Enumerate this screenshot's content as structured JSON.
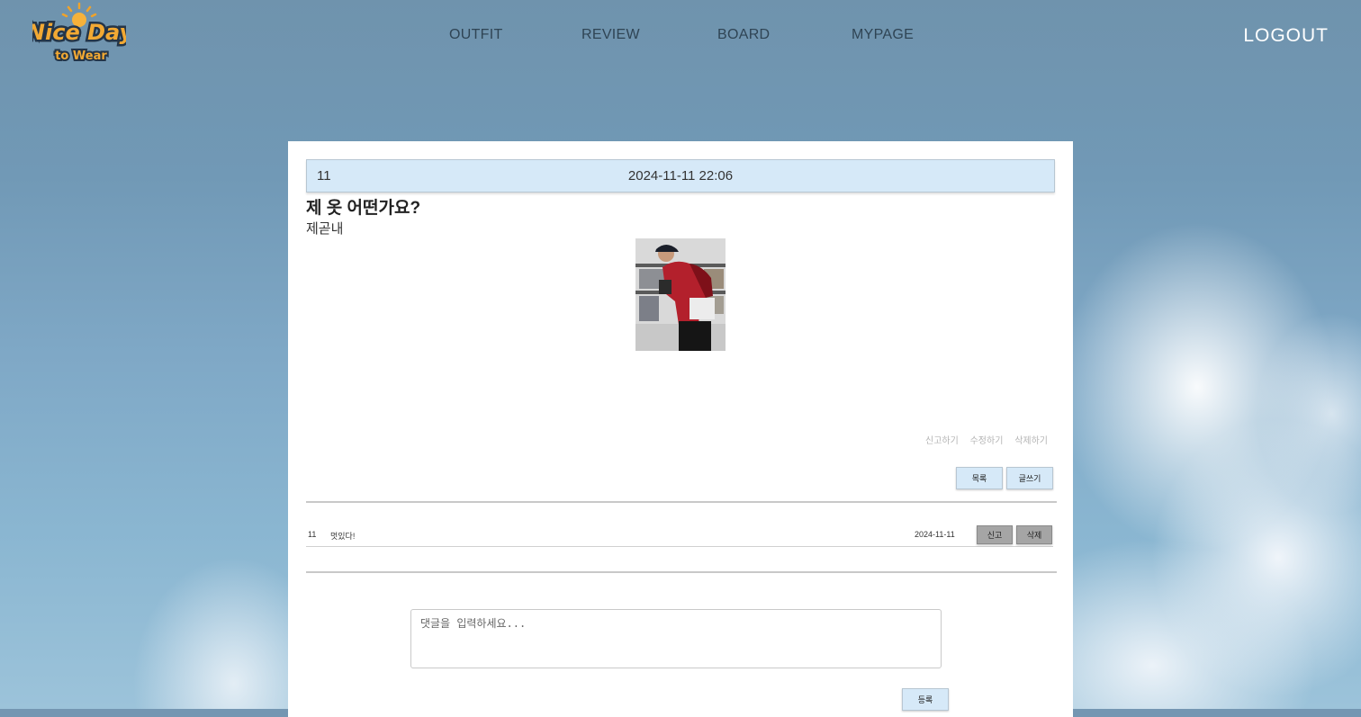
{
  "brand": {
    "line1": "Nice Day",
    "line2": "to Wear"
  },
  "nav": {
    "items": [
      "OUTFIT",
      "REVIEW",
      "BOARD",
      "MYPAGE"
    ],
    "logout": "LOGOUT"
  },
  "post": {
    "number": "11",
    "datetime": "2024-11-11 22:06",
    "title": "제 옷 어떤가요?",
    "author": "제곧내",
    "actions": {
      "report": "신고하기",
      "edit": "수정하기",
      "delete": "삭제하기"
    },
    "buttons": {
      "list": "목록",
      "write": "글쓰기"
    }
  },
  "comments": [
    {
      "number": "11",
      "text": "멋있다!",
      "date": "2024-11-11",
      "report": "신고",
      "delete": "삭제"
    }
  ],
  "comment_form": {
    "placeholder": "댓글을 입력하세요...",
    "submit": "등록"
  },
  "colors": {
    "header_bar": "#d6e9f8",
    "nav_text": "#2f4454",
    "logo_text": "#f2a933"
  }
}
